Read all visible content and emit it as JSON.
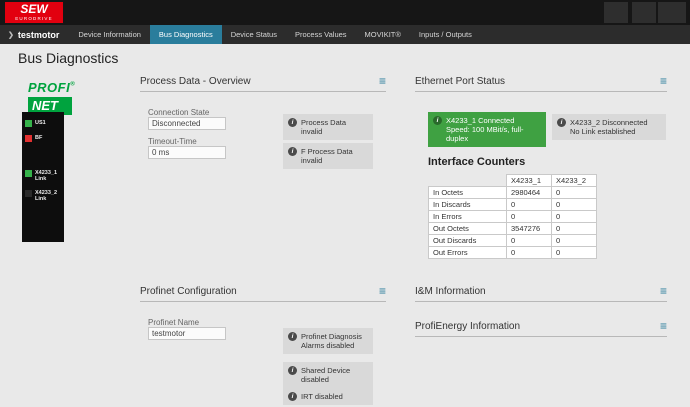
{
  "titlebar": {
    "logo_line1": "SEW",
    "logo_line2": "EURODRIVE"
  },
  "icons": {
    "info": "i",
    "collapse": "≡",
    "breadcrumb_arrow": "❯"
  },
  "nav": {
    "breadcrumb": "testmotor",
    "tabs": [
      {
        "label": "Device Information"
      },
      {
        "label": "Bus Diagnostics"
      },
      {
        "label": "Device Status"
      },
      {
        "label": "Process Values"
      },
      {
        "label": "MOVIKIT®"
      },
      {
        "label": "Inputs / Outputs"
      }
    ]
  },
  "page": {
    "title": "Bus Diagnostics"
  },
  "device": {
    "profinet_logo": {
      "line1": "PROFI",
      "line2": "NET",
      "reg": "®"
    },
    "leds": [
      {
        "label": "US1",
        "state": "green"
      },
      {
        "label": "BF",
        "state": "red"
      },
      {
        "label": "X4233_1 Link",
        "state": "green"
      },
      {
        "label": "X4233_2 Link",
        "state": "off"
      }
    ]
  },
  "sections": {
    "process_data": {
      "title": "Process Data - Overview",
      "fields": [
        {
          "label": "Connection State",
          "value": "Disconnected"
        },
        {
          "label": "Timeout-Time",
          "value": "0 ms"
        }
      ],
      "badges": [
        "Process Data invalid",
        "F Process Data invalid"
      ]
    },
    "ethernet": {
      "title": "Ethernet Port Status",
      "ports": [
        {
          "name": "X4233_1 Connected",
          "detail": "Speed: 100 MBit/s, full-duplex"
        },
        {
          "name": "X4233_2 Disconnected",
          "detail": "No Link established"
        }
      ],
      "counters": {
        "title": "Interface Counters",
        "columns": [
          "X4233_1",
          "X4233_2"
        ],
        "rows": [
          {
            "label": "In Octets",
            "x4233_1": "2980464",
            "x4233_2": "0"
          },
          {
            "label": "In Discards",
            "x4233_1": "0",
            "x4233_2": "0"
          },
          {
            "label": "In Errors",
            "x4233_1": "0",
            "x4233_2": "0"
          },
          {
            "label": "Out Octets",
            "x4233_1": "3547276",
            "x4233_2": "0"
          },
          {
            "label": "Out Discards",
            "x4233_1": "0",
            "x4233_2": "0"
          },
          {
            "label": "Out Errors",
            "x4233_1": "0",
            "x4233_2": "0"
          }
        ]
      }
    },
    "profinet_config": {
      "title": "Profinet Configuration",
      "fields": [
        {
          "label": "Profinet Name",
          "value": "testmotor"
        }
      ],
      "badges": [
        "Profinet Diagnosis Alarms disabled",
        "Shared Device disabled",
        "IRT disabled"
      ]
    },
    "im_information": {
      "title": "I&M Information"
    },
    "profienergy": {
      "title": "ProfiEnergy Information"
    }
  },
  "colors": {
    "accent": "#2a7d9c",
    "badge_green": "#3fa142",
    "led_green": "#35b24a",
    "led_red": "#e23131",
    "sew_red": "#e2000f",
    "profinet_green": "#00a33e"
  }
}
